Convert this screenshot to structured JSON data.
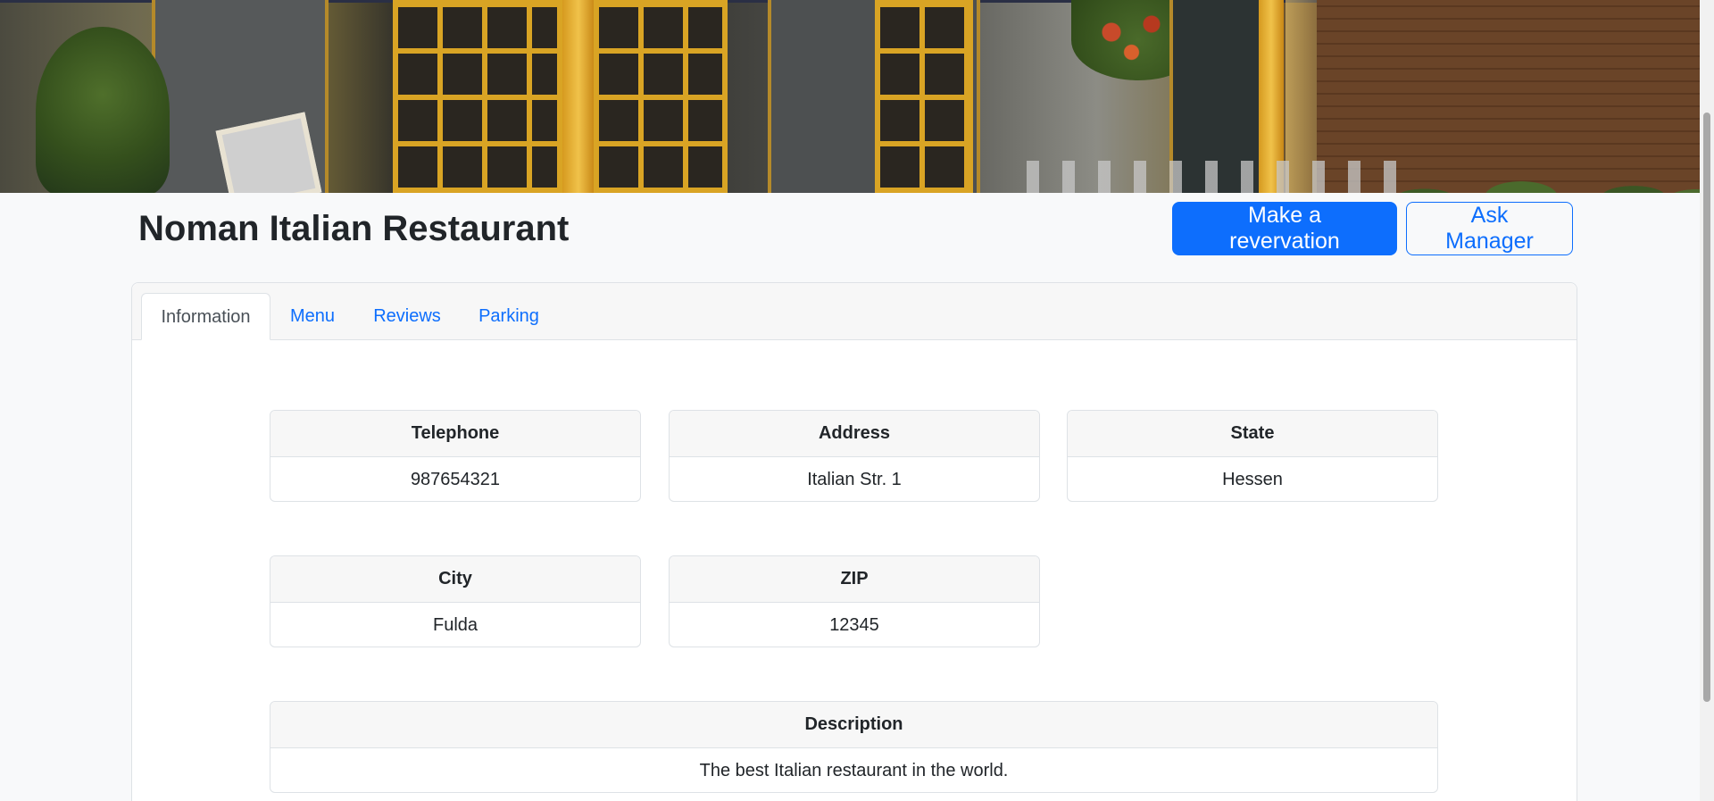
{
  "restaurant": {
    "name": "Noman Italian Restaurant"
  },
  "actions": {
    "reservation_label": "Make a revervation",
    "ask_manager_label": "Ask Manager"
  },
  "tabs": [
    {
      "label": "Information",
      "active": true
    },
    {
      "label": "Menu",
      "active": false
    },
    {
      "label": "Reviews",
      "active": false
    },
    {
      "label": "Parking",
      "active": false
    }
  ],
  "info": {
    "telephone": {
      "label": "Telephone",
      "value": "987654321"
    },
    "address": {
      "label": "Address",
      "value": "Italian Str. 1"
    },
    "state": {
      "label": "State",
      "value": "Hessen"
    },
    "city": {
      "label": "City",
      "value": "Fulda"
    },
    "zip": {
      "label": "ZIP",
      "value": "12345"
    },
    "description": {
      "label": "Description",
      "value": "The best Italian restaurant in the world."
    }
  },
  "colors": {
    "primary": "#0d6efd",
    "page_background": "#f8f9fa",
    "border": "#dee2e6"
  }
}
